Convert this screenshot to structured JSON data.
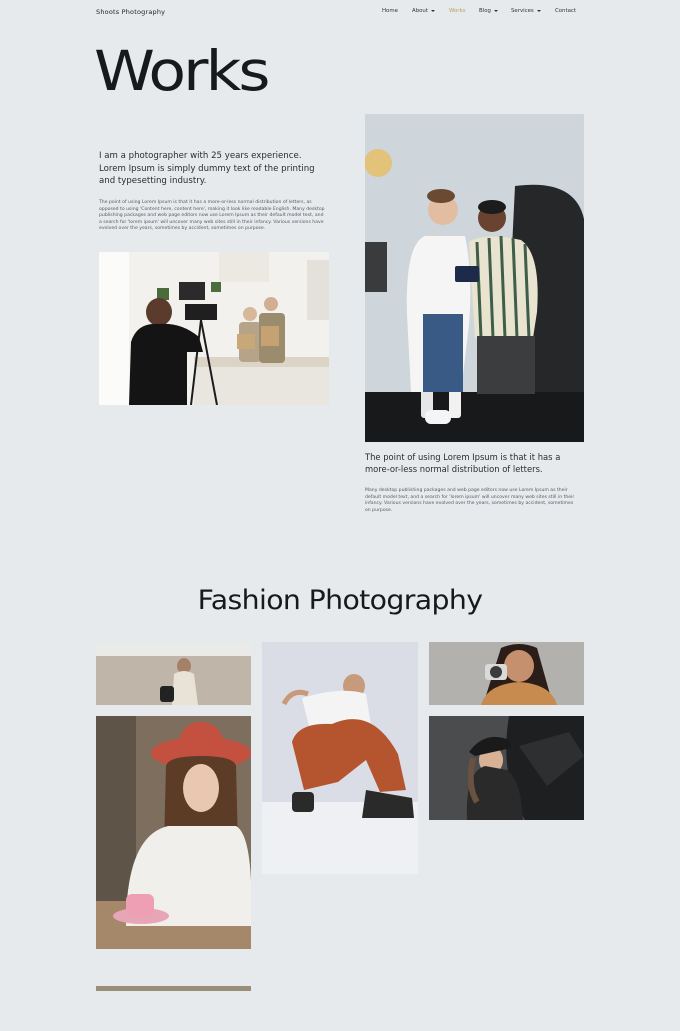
{
  "nav": {
    "brand": "Shoots Photography",
    "items": [
      {
        "label": "Home"
      },
      {
        "label": "About"
      },
      {
        "label": "Works",
        "active": true
      },
      {
        "label": "Blog"
      },
      {
        "label": "Services"
      },
      {
        "label": "Contact"
      }
    ],
    "active_color": "#b9a35a"
  },
  "hero": {
    "title": "Works",
    "lead": "I am a photographer with 25 years experience. Lorem Ipsum is simply dummy text of the printing and typesetting industry.",
    "body": "The point of using Lorem Ipsum is that it has a more-or-less normal distribution of letters, as opposed to using 'Content here, content here', making it look like readable English. Many desktop publishing packages and web page editors now use Lorem Ipsum as their default model text, and a search for 'lorem ipsum' will uncover many web sites still in their infancy. Various versions have evolved over the years, sometimes by accident, sometimes on purpose."
  },
  "feature": {
    "caption": "The point of using Lorem Ipsum is that it has a more-or-less normal distribution of letters.",
    "body": "Many desktop publishing packages and web page editors now use Lorem Ipsum as their default model text, and a search for 'lorem ipsum' will uncover many web sites still in their infancy. Various versions have evolved over the years, sometimes by accident, sometimes on purpose."
  },
  "fashion": {
    "title": "Fashion Photography"
  }
}
